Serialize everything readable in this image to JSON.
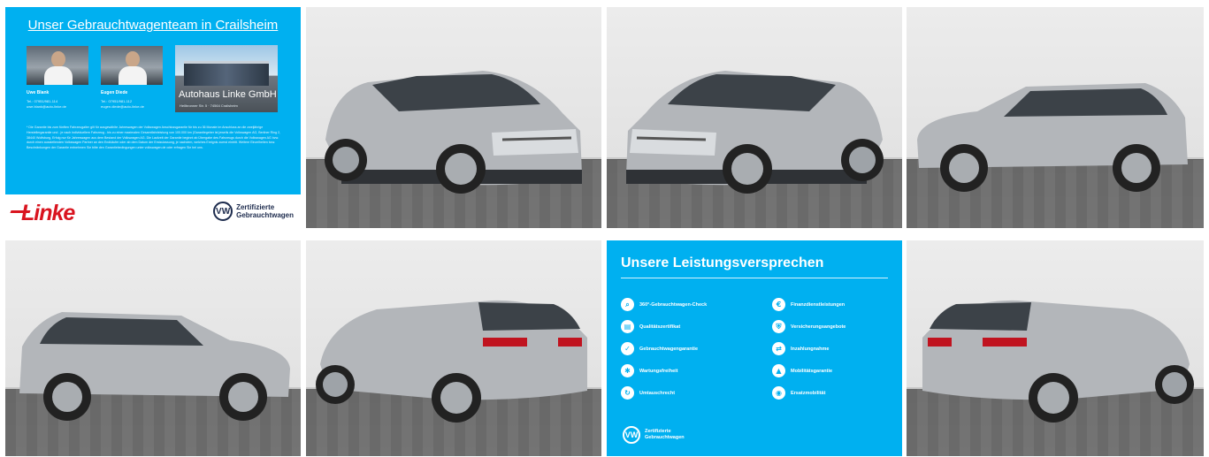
{
  "team_card": {
    "title": "Unser Gebrauchtwagenteam in Crailsheim",
    "persons": [
      {
        "name": "Uwe Blank",
        "phone": "Tel.: 07951/981-114",
        "email": "uwe.blank@auto-linke.de"
      },
      {
        "name": "Eugen Diede",
        "phone": "Tel.: 07951/981-112",
        "email": "eugen.diede@auto-linke.de"
      }
    ],
    "dealer_name": "Autohaus Linke GmbH",
    "dealer_address": "Heilbronner Str. 5 · 74564 Crailsheim",
    "disclaimer": "* Die Garantie bis zum fünften Fahrzeugalter gilt für ausgewählte Jahreswagen der Volkswagen Anschlussgarantie für bis zu 36 Monate im Anschluss an die zweijährige Herstellergarantie und - je nach individuellem Fahrzeug - bis zu einer maximalen Gesamtfahrleistung von 100.000 km (Garantiegeber ist jeweils die Volkswagen AG, Berliner Ring 2, 38440 Wolfsburg, Erfolg nur für Jahreswagen aus dem Bestand der Volkswagen AG. Die Laufzeit der Garantie beginnt ab Übergabe des Fahrzeugs durch die Volkswagen AG bzw. durch einen ausstellenden Volkswagen Partner an den Endkäufer oder ab dem Datum der Erstzulassung, je nachdem, welches Ereignis zuerst eintritt. Weitere Einzelheiten bzw. Beschränkungen der Garantie entnehmen Sie bitte den Garantiebedingungen unter volkswagen.de oder erfragen Sie bei uns.",
    "brand_logo_text": "Linke",
    "vw_mark": "VW",
    "vw_label_line1": "Zertifizierte",
    "vw_label_line2": "Gebrauchtwagen"
  },
  "gallery": [
    {
      "name": "front-left-photo",
      "view": "front-left"
    },
    {
      "name": "front-right-photo",
      "view": "front-right"
    },
    {
      "name": "side-left-photo",
      "view": "side-left"
    },
    {
      "name": "side-right-photo",
      "view": "side-right"
    },
    {
      "name": "rear-left-photo",
      "view": "rear-left"
    },
    {
      "name": "rear-right-photo",
      "view": "rear-right"
    }
  ],
  "promise_card": {
    "title": "Unsere Leistungsversprechen",
    "items": [
      {
        "label": "360°-Gebrauchtwagen-Check",
        "icon": "search-icon"
      },
      {
        "label": "Finanzdienstleistungen",
        "icon": "coins-icon"
      },
      {
        "label": "Qualitätszertifikat",
        "icon": "certificate-icon"
      },
      {
        "label": "Versicherungsangebote",
        "icon": "shield-icon"
      },
      {
        "label": "Gebrauchtwagengarantie",
        "icon": "check-shield-icon"
      },
      {
        "label": "Inzahlungnahme",
        "icon": "car-exchange-icon"
      },
      {
        "label": "Wartungsfreiheit",
        "icon": "wrench-icon"
      },
      {
        "label": "Mobilitätsgarantie",
        "icon": "road-icon"
      },
      {
        "label": "Umtauschrecht",
        "icon": "swap-icon"
      },
      {
        "label": "Ersatzmobilität",
        "icon": "car-icon"
      }
    ],
    "vw_mark": "VW",
    "vw_label_line1": "Zertifizierte",
    "vw_label_line2": "Gebrauchtwagen"
  },
  "colors": {
    "accent_blue": "#00b0f0",
    "linke_red": "#d9141f",
    "car_silver": "#b3b6ba"
  }
}
